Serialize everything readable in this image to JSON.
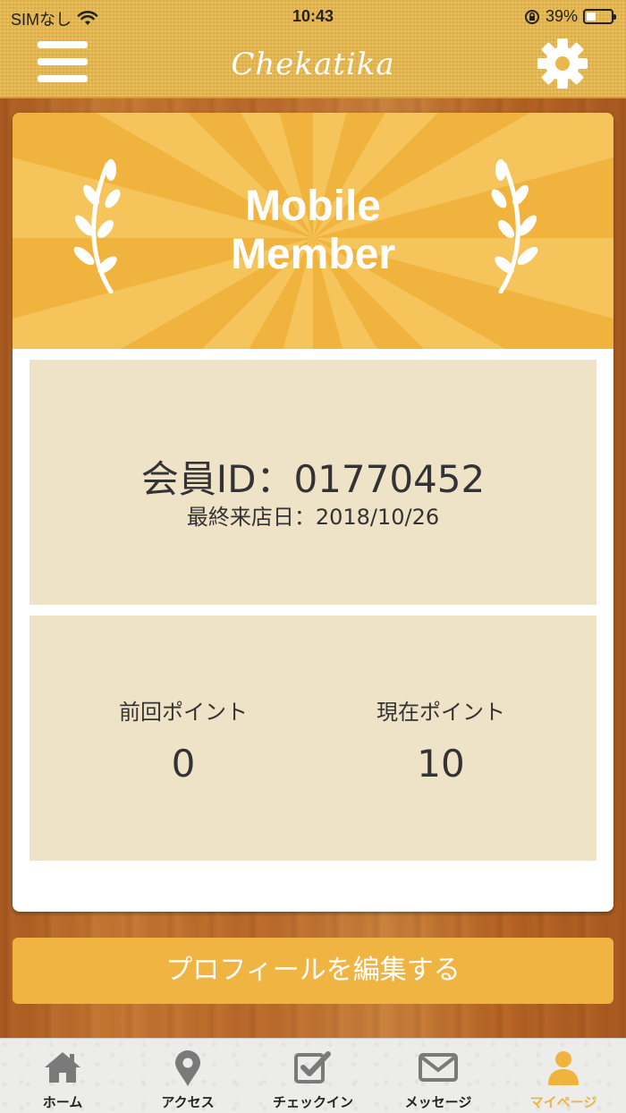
{
  "status_bar": {
    "carrier": "SIMなし",
    "time": "10:43",
    "battery": "39%"
  },
  "header": {
    "brand": "Chekatika",
    "menu_icon": "hamburger-menu-icon",
    "settings_icon": "gear-icon"
  },
  "banner": {
    "title_line1": "Mobile",
    "title_line2": "Member"
  },
  "member": {
    "id_text": "会員ID：01770452",
    "last_visit_text": "最終来店日：2018/10/26"
  },
  "points": {
    "previous_label": "前回ポイント",
    "previous_value": "0",
    "current_label": "現在ポイント",
    "current_value": "10"
  },
  "edit_button": "プロフィールを編集する",
  "tabs": [
    {
      "label": "ホーム",
      "icon": "home-icon"
    },
    {
      "label": "アクセス",
      "icon": "map-pin-icon"
    },
    {
      "label": "チェックイン",
      "icon": "checkbox-icon"
    },
    {
      "label": "メッセージ",
      "icon": "envelope-icon"
    },
    {
      "label": "マイページ",
      "icon": "user-icon",
      "active": true
    }
  ],
  "colors": {
    "accent": "#f0b43e",
    "panel": "#efe3c7",
    "header": "#e8b84c"
  }
}
